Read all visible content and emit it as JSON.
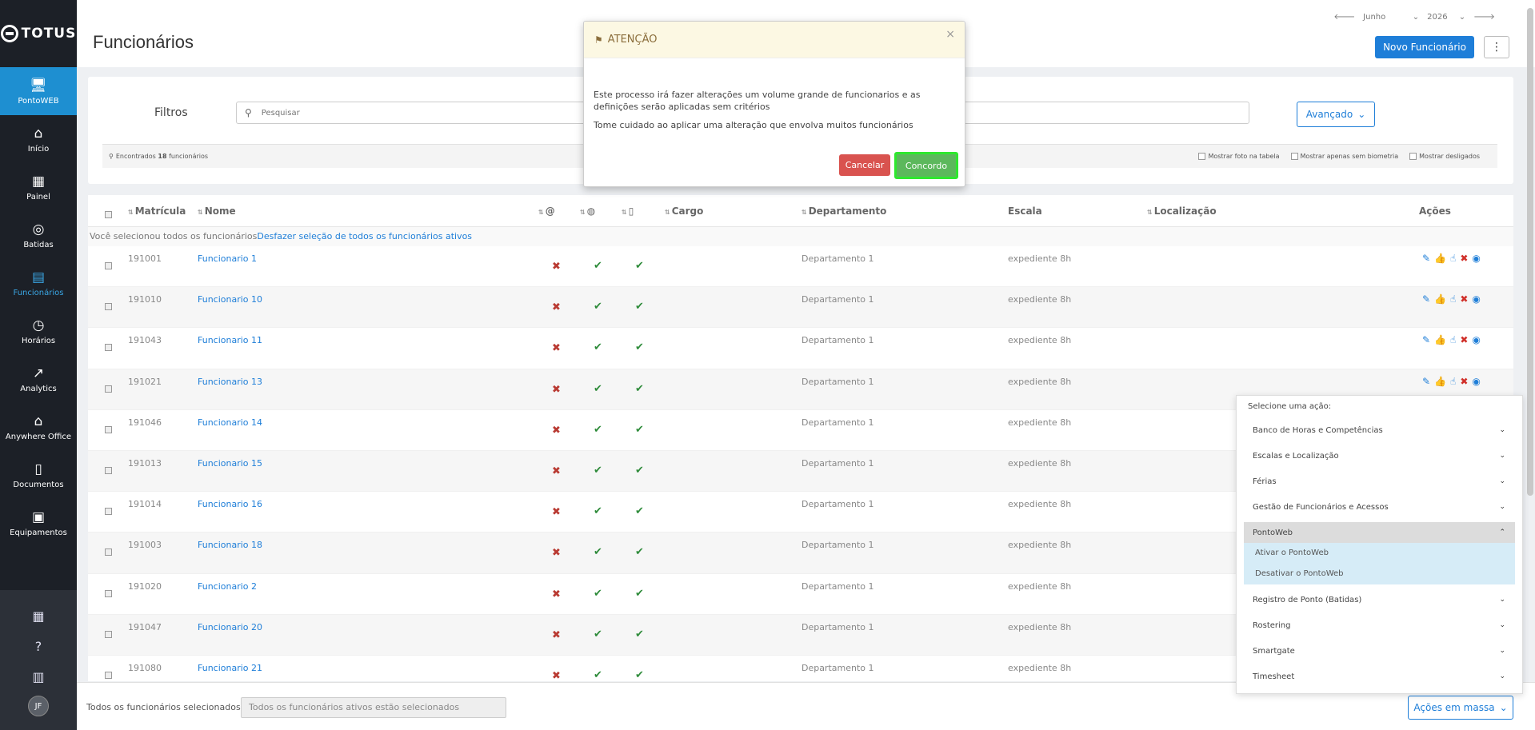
{
  "brand": "TOTUS",
  "nav": [
    {
      "label": "PontoWEB",
      "icon": "monitor-icon",
      "glyph": "🖥"
    },
    {
      "label": "Início",
      "icon": "home-icon",
      "glyph": "⌂"
    },
    {
      "label": "Painel",
      "icon": "dashboard-icon",
      "glyph": "▦"
    },
    {
      "label": "Batidas",
      "icon": "fingerprint-icon",
      "glyph": "◎"
    },
    {
      "label": "Funcionários",
      "icon": "badge-icon",
      "glyph": "▤"
    },
    {
      "label": "Horários",
      "icon": "clock-icon",
      "glyph": "◷"
    },
    {
      "label": "Analytics",
      "icon": "trend-icon",
      "glyph": "↗"
    },
    {
      "label": "Anywhere Office",
      "icon": "house-icon",
      "glyph": "⌂"
    },
    {
      "label": "Documentos",
      "icon": "document-icon",
      "glyph": "▯"
    },
    {
      "label": "Equipamentos",
      "icon": "device-icon",
      "glyph": "▣"
    }
  ],
  "user_initials": "JF",
  "page": {
    "title": "Funcionários",
    "period_month": "Junho",
    "period_year": "2026",
    "new_button": "Novo Funcionário"
  },
  "filters": {
    "label": "Filtros",
    "search_placeholder": "Pesquisar",
    "advanced": "Avançado",
    "found_prefix": "Encontrados",
    "found_count": "18",
    "found_suffix": "funcionários",
    "opt_photo": "Mostrar foto na tabela",
    "opt_biometry": "Mostrar apenas sem biometria",
    "opt_disabled": "Mostrar desligados"
  },
  "table": {
    "headers": {
      "matricula": "Matrícula",
      "nome": "Nome",
      "cargo": "Cargo",
      "departamento": "Departamento",
      "escala": "Escala",
      "localizacao": "Localização",
      "acoes": "Ações"
    },
    "selection_note": "Você selecionou todos os funcionários",
    "undo_selection": "Desfazer seleção de todos os funcionários ativos",
    "rows": [
      {
        "matricula": "191001",
        "nome": "Funcionario 1",
        "departamento": "Departamento 1",
        "escala": "expediente 8h"
      },
      {
        "matricula": "191010",
        "nome": "Funcionario 10",
        "departamento": "Departamento 1",
        "escala": "expediente 8h"
      },
      {
        "matricula": "191043",
        "nome": "Funcionario 11",
        "departamento": "Departamento 1",
        "escala": "expediente 8h"
      },
      {
        "matricula": "191021",
        "nome": "Funcionario 13",
        "departamento": "Departamento 1",
        "escala": "expediente 8h"
      },
      {
        "matricula": "191046",
        "nome": "Funcionario 14",
        "departamento": "Departamento 1",
        "escala": "expediente 8h"
      },
      {
        "matricula": "191013",
        "nome": "Funcionario 15",
        "departamento": "Departamento 1",
        "escala": "expediente 8h"
      },
      {
        "matricula": "191014",
        "nome": "Funcionario 16",
        "departamento": "Departamento 1",
        "escala": "expediente 8h"
      },
      {
        "matricula": "191003",
        "nome": "Funcionario 18",
        "departamento": "Departamento 1",
        "escala": "expediente 8h"
      },
      {
        "matricula": "191020",
        "nome": "Funcionario 2",
        "departamento": "Departamento 1",
        "escala": "expediente 8h"
      },
      {
        "matricula": "191047",
        "nome": "Funcionario 20",
        "departamento": "Departamento 1",
        "escala": "expediente 8h"
      },
      {
        "matricula": "191080",
        "nome": "Funcionario 21",
        "departamento": "Departamento 1",
        "escala": "expediente 8h"
      }
    ]
  },
  "bottom": {
    "label": "Todos os funcionários selecionados",
    "input_value": "Todos os funcionários ativos estão selecionados",
    "bulk_button": "Ações em massa"
  },
  "action_menu": {
    "title": "Selecione uma ação:",
    "items_before": [
      "Banco de Horas e Competências",
      "Escalas e Localização",
      "Férias",
      "Gestão de Funcionários e Acessos"
    ],
    "open_item": "PontoWeb",
    "sub_items": [
      "Ativar o PontoWeb",
      "Desativar o PontoWeb"
    ],
    "items_after": [
      "Registro de Ponto (Batidas)",
      "Rostering",
      "Smartgate",
      "Timesheet"
    ]
  },
  "modal": {
    "title": "ATENÇÃO",
    "line1": "Este processo irá fazer alterações um volume grande de funcionarios e as definições serão aplicadas sem critérios",
    "line2": "Tome cuidado ao aplicar uma alteração que envolva muitos funcionários",
    "cancel": "Cancelar",
    "agree": "Concordo"
  },
  "colors": {
    "accent": "#1e7ed8",
    "sidebar": "#1c2027",
    "danger": "#d9534f",
    "success": "#5cb85c",
    "highlight": "#2ee82e"
  }
}
